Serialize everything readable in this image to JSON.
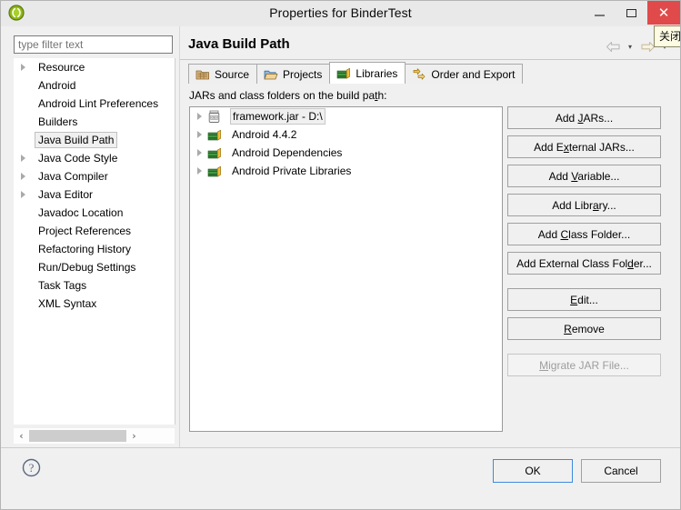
{
  "window": {
    "title": "Properties for BinderTest",
    "app_icon": "eclipse-icon",
    "minimize_label": "—",
    "maximize_label": "□",
    "close_label": "✕",
    "tooltip": "关闭"
  },
  "sidebar": {
    "filter_placeholder": "type filter text",
    "filter_value": "",
    "items": [
      {
        "label": "Resource",
        "expandable": true,
        "selected": false
      },
      {
        "label": "Android",
        "expandable": false,
        "selected": false
      },
      {
        "label": "Android Lint Preferences",
        "expandable": false,
        "selected": false
      },
      {
        "label": "Builders",
        "expandable": false,
        "selected": false
      },
      {
        "label": "Java Build Path",
        "expandable": false,
        "selected": true
      },
      {
        "label": "Java Code Style",
        "expandable": true,
        "selected": false
      },
      {
        "label": "Java Compiler",
        "expandable": true,
        "selected": false
      },
      {
        "label": "Java Editor",
        "expandable": true,
        "selected": false
      },
      {
        "label": "Javadoc Location",
        "expandable": false,
        "selected": false
      },
      {
        "label": "Project References",
        "expandable": false,
        "selected": false
      },
      {
        "label": "Refactoring History",
        "expandable": false,
        "selected": false
      },
      {
        "label": "Run/Debug Settings",
        "expandable": false,
        "selected": false
      },
      {
        "label": "Task Tags",
        "expandable": false,
        "selected": false
      },
      {
        "label": "XML Syntax",
        "expandable": false,
        "selected": false
      }
    ],
    "scroll_left_arrow": "‹",
    "scroll_right_arrow": "›"
  },
  "page": {
    "title": "Java Build Path",
    "back_icon": "back-arrow-icon",
    "forward_icon": "forward-arrow-icon",
    "caret_icon": "▾"
  },
  "tabs": [
    {
      "label": "Source",
      "icon": "source-folder-icon",
      "active": false
    },
    {
      "label": "Projects",
      "icon": "projects-folder-icon",
      "active": false
    },
    {
      "label": "Libraries",
      "icon": "libraries-books-icon",
      "active": true
    },
    {
      "label": "Order and Export",
      "icon": "order-export-arrows-icon",
      "active": false
    }
  ],
  "main": {
    "section_label_pre": "JARs and class folders on the build pa",
    "section_label_mnemonic": "t",
    "section_label_post": "h:",
    "jars": [
      {
        "label": "framework.jar - D:\\",
        "icon": "jar-file-icon",
        "selected": true
      },
      {
        "label": "Android 4.4.2",
        "icon": "library-books-icon",
        "selected": false
      },
      {
        "label": "Android Dependencies",
        "icon": "library-books-icon",
        "selected": false
      },
      {
        "label": "Android Private Libraries",
        "icon": "library-books-icon",
        "selected": false
      }
    ],
    "buttons": [
      {
        "pre": "Add ",
        "mn": "J",
        "post": "ARs...",
        "disabled": false,
        "gap": false,
        "name": "add-jars-button"
      },
      {
        "pre": "Add E",
        "mn": "x",
        "post": "ternal JARs...",
        "disabled": false,
        "gap": false,
        "name": "add-external-jars-button"
      },
      {
        "pre": "Add ",
        "mn": "V",
        "post": "ariable...",
        "disabled": false,
        "gap": false,
        "name": "add-variable-button"
      },
      {
        "pre": "Add Libr",
        "mn": "a",
        "post": "ry...",
        "disabled": false,
        "gap": false,
        "name": "add-library-button"
      },
      {
        "pre": "Add ",
        "mn": "C",
        "post": "lass Folder...",
        "disabled": false,
        "gap": false,
        "name": "add-class-folder-button"
      },
      {
        "pre": "Add External Class Fol",
        "mn": "d",
        "post": "er...",
        "disabled": false,
        "gap": false,
        "name": "add-external-class-folder-button"
      },
      {
        "pre": "",
        "mn": "E",
        "post": "dit...",
        "disabled": false,
        "gap": true,
        "name": "edit-button"
      },
      {
        "pre": "",
        "mn": "R",
        "post": "emove",
        "disabled": false,
        "gap": false,
        "name": "remove-button"
      },
      {
        "pre": "",
        "mn": "M",
        "post": "igrate JAR File...",
        "disabled": true,
        "gap": true,
        "name": "migrate-jar-file-button"
      }
    ]
  },
  "footer": {
    "help_icon": "help-question-icon",
    "ok_label": "OK",
    "cancel_label": "Cancel"
  },
  "colors": {
    "close_button": "#e04a4a",
    "ok_focus_border": "#3c8adf",
    "tooltip_bg": "#fdfbe3",
    "dialog_bg": "#f0f0f0"
  }
}
